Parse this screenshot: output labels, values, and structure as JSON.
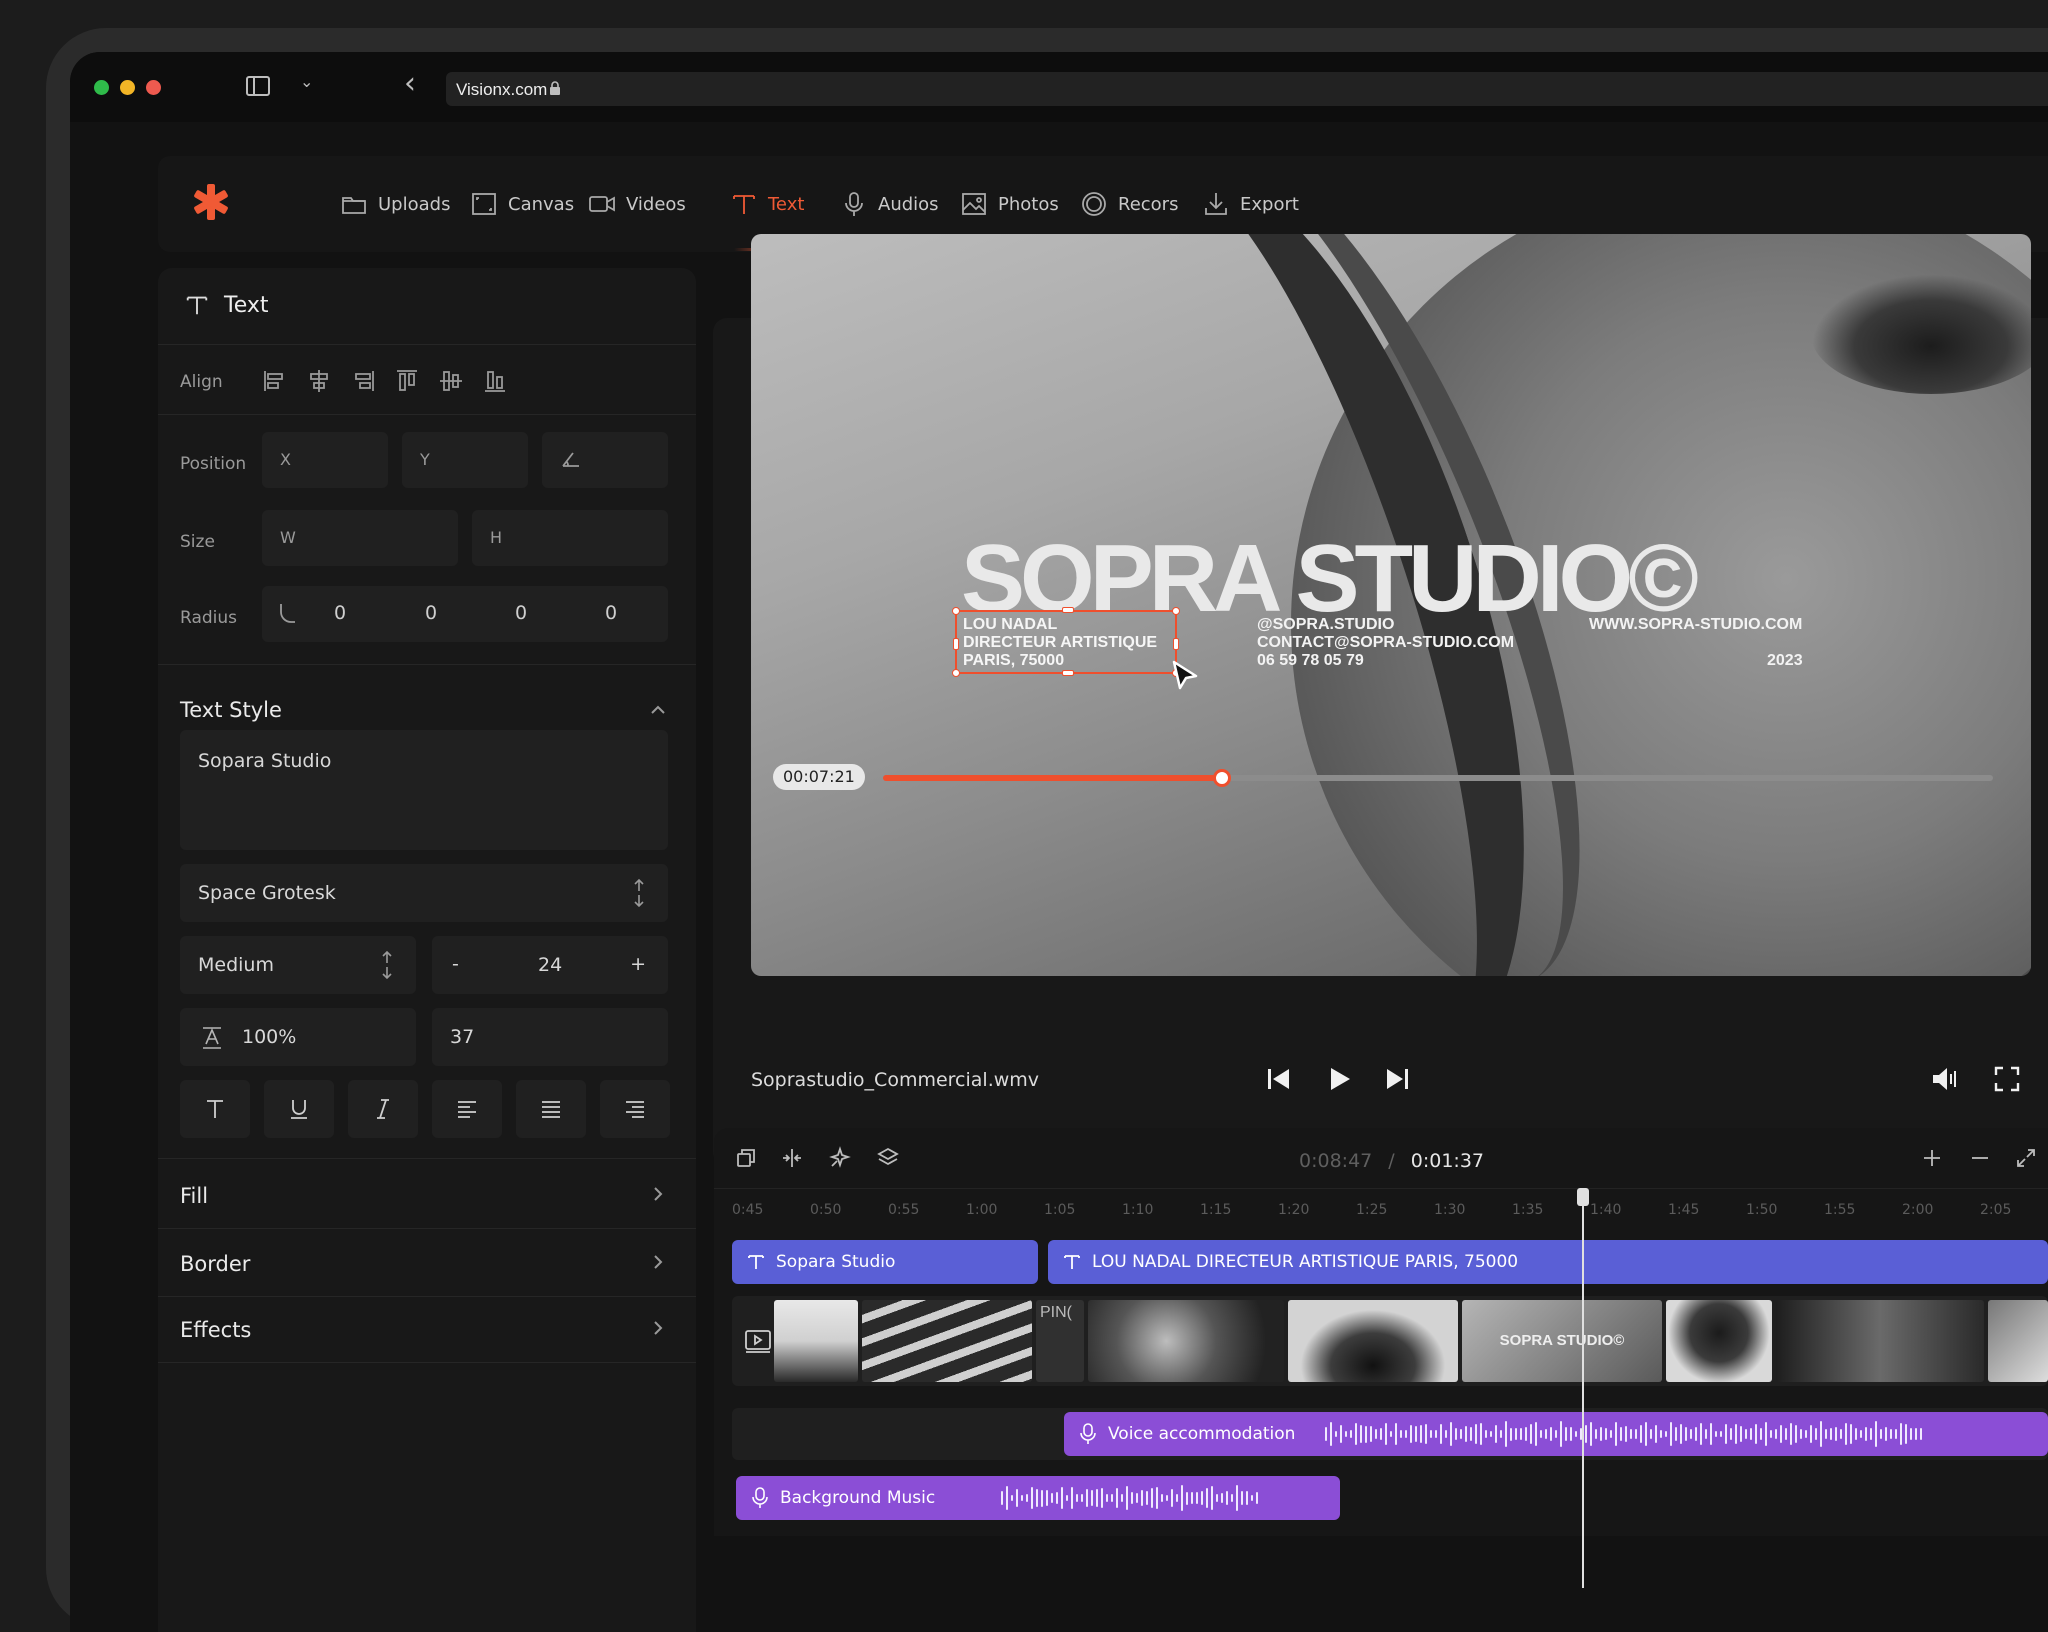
{
  "browser": {
    "url": "Visionx.com"
  },
  "nav": {
    "items": [
      {
        "label": "Uploads",
        "icon": "folder-icon"
      },
      {
        "label": "Canvas",
        "icon": "canvas-icon"
      },
      {
        "label": "Videos",
        "icon": "video-camera-icon"
      },
      {
        "label": "Text",
        "icon": "text-icon",
        "active": true
      },
      {
        "label": "Audios",
        "icon": "microphone-icon"
      },
      {
        "label": "Photos",
        "icon": "image-icon"
      },
      {
        "label": "Recors",
        "icon": "record-icon"
      },
      {
        "label": "Export",
        "icon": "download-icon"
      }
    ],
    "accent": "#f05a35"
  },
  "panel": {
    "title": "Text",
    "align_label": "Align",
    "position_label": "Position",
    "position": {
      "x": "X",
      "y": "Y"
    },
    "size_label": "Size",
    "size": {
      "w": "W",
      "h": "H"
    },
    "radius_label": "Radius",
    "radius": [
      "0",
      "0",
      "0",
      "0"
    ],
    "text_style_label": "Text Style",
    "text_value": "Sopara Studio",
    "font_family": "Space Grotesk",
    "font_weight": "Medium",
    "font_size": "24",
    "decrement": "-",
    "increment": "+",
    "opacity": "100%",
    "line_height": "37",
    "fill_label": "Fill",
    "border_label": "Border",
    "effects_label": "Effects"
  },
  "video": {
    "brand_title": "SOPRA STUDIO©",
    "info_left": "LOU NADAL\nDIRECTEUR ARTISTIQUE\nPARIS, 75000",
    "info_mid": "@SOPRA.STUDIO\nCONTACT@SOPRA-STUDIO.COM\n06 59 78 05 79",
    "info_right_url": "WWW.SOPRA-STUDIO.COM",
    "info_right_year": "2023",
    "current_time": "00:07:21",
    "progress": 0.305,
    "filename": "Soprastudio_Commercial.wmv"
  },
  "timeline": {
    "total_time": "0:08:47",
    "separator": "/",
    "current_time": "0:01:37",
    "ticks": [
      "0:45",
      "0:50",
      "0:55",
      "1:00",
      "1:05",
      "1:10",
      "1:15",
      "1:20",
      "1:25",
      "1:30",
      "1:35",
      "1:40",
      "1:45",
      "1:50",
      "1:55",
      "2:00",
      "2:05"
    ],
    "text_clips": [
      "Sopara Studio",
      "LOU NADAL DIRECTEUR ARTISTIQUE PARIS, 75000"
    ],
    "thumb_label_1": "PIN(",
    "thumb_label_2": "SOPRA STUDIO©",
    "audio_clips": [
      "Voice accommodation",
      "Background Music"
    ],
    "text_clip_color": "#5a5fd6",
    "audio_clip_color": "#8b4ed6"
  }
}
